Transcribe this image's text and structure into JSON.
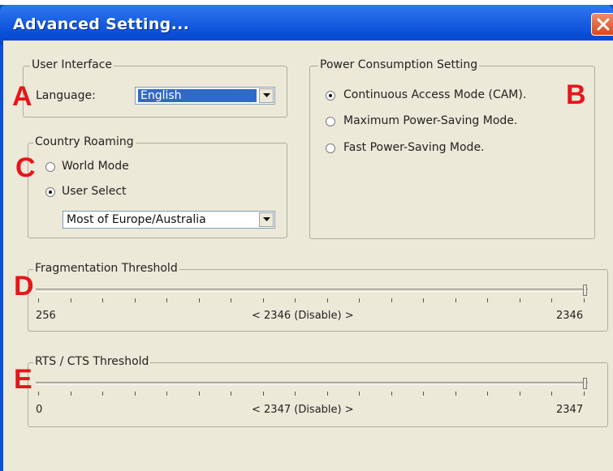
{
  "window": {
    "title": "Advanced Setting..."
  },
  "markers": {
    "a": "A",
    "b": "B",
    "c": "C",
    "d": "D",
    "e": "E"
  },
  "user_interface": {
    "legend": "User Interface",
    "language_label": "Language:",
    "language_value": "English"
  },
  "country_roaming": {
    "legend": "Country Roaming",
    "options": [
      {
        "label": "World Mode",
        "checked": false
      },
      {
        "label": "User Select",
        "checked": true
      }
    ],
    "region_value": "Most of Europe/Australia"
  },
  "power": {
    "legend": "Power Consumption Setting",
    "options": [
      {
        "label": "Continuous Access Mode (CAM).",
        "checked": true
      },
      {
        "label": "Maximum Power-Saving Mode.",
        "checked": false
      },
      {
        "label": "Fast Power-Saving Mode.",
        "checked": false
      }
    ]
  },
  "fragmentation": {
    "legend": "Fragmentation Threshold",
    "min": "256",
    "max": "2346",
    "current": "< 2346 (Disable) >",
    "value_fraction": 1.0,
    "tick_count": 18
  },
  "rts": {
    "legend": "RTS / CTS Threshold",
    "min": "0",
    "max": "2347",
    "current": "< 2347 (Disable) >",
    "value_fraction": 1.0,
    "tick_count": 18
  },
  "colors": {
    "accent": "#0a4fd8",
    "marker": "#e8141a",
    "selection": "#316ac5"
  }
}
